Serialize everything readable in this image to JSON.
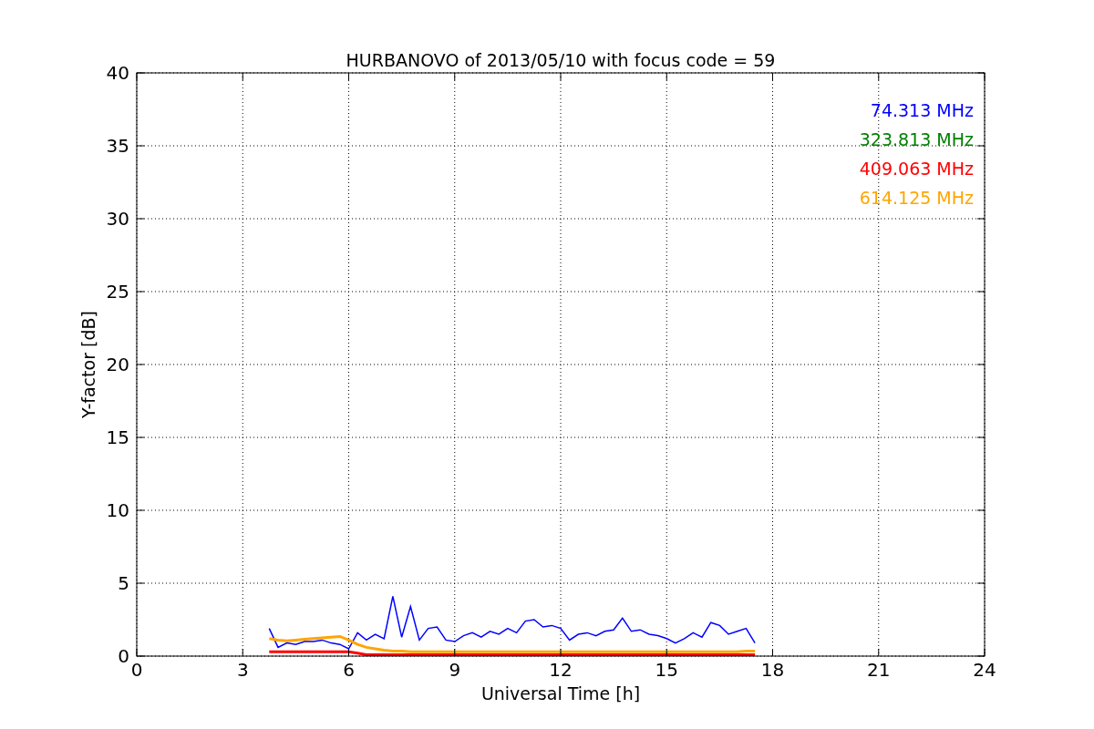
{
  "chart_data": {
    "type": "line",
    "title": "HURBANOVO of 2013/05/10 with focus code = 59",
    "xlabel": "Universal Time [h]",
    "ylabel": "Y-factor [dB]",
    "grid": true,
    "xlim": [
      0,
      24
    ],
    "ylim": [
      0,
      40
    ],
    "xticks": [
      0,
      3,
      6,
      9,
      12,
      15,
      18,
      21,
      24
    ],
    "yticks": [
      0,
      5,
      10,
      15,
      20,
      25,
      30,
      35,
      40
    ],
    "x": [
      3.75,
      4,
      4.25,
      4.5,
      4.75,
      5,
      5.25,
      5.5,
      5.75,
      6,
      6.25,
      6.5,
      6.75,
      7,
      7.25,
      7.5,
      7.75,
      8,
      8.25,
      8.5,
      8.75,
      9,
      9.25,
      9.5,
      9.75,
      10,
      10.25,
      10.5,
      10.75,
      11,
      11.25,
      11.5,
      11.75,
      12,
      12.25,
      12.5,
      12.75,
      13,
      13.25,
      13.5,
      13.75,
      14,
      14.25,
      14.5,
      14.75,
      15,
      15.25,
      15.5,
      15.75,
      16,
      16.25,
      16.5,
      16.75,
      17,
      17.25,
      17.5
    ],
    "series": [
      {
        "name": "74.313 MHz",
        "color": "#0000ff",
        "values": [
          1.9,
          0.6,
          0.9,
          0.8,
          1.0,
          1.0,
          1.1,
          0.9,
          0.8,
          0.5,
          1.6,
          1.1,
          1.5,
          1.2,
          4.1,
          1.3,
          3.4,
          1.1,
          1.9,
          2.0,
          1.1,
          1.0,
          1.4,
          1.6,
          1.3,
          1.7,
          1.5,
          1.9,
          1.6,
          2.4,
          2.5,
          2.0,
          2.1,
          1.9,
          1.1,
          1.5,
          1.6,
          1.4,
          1.7,
          1.8,
          2.6,
          1.7,
          1.8,
          1.5,
          1.4,
          1.2,
          0.9,
          1.2,
          1.6,
          1.3,
          2.3,
          2.1,
          1.5,
          1.7,
          1.9,
          0.9
        ]
      },
      {
        "name": "323.813 MHz",
        "color": "#008000",
        "values": [
          null,
          null,
          null,
          null,
          null,
          null,
          null,
          null,
          null,
          null,
          null,
          null,
          null,
          null,
          null,
          null,
          null,
          null,
          null,
          null,
          null,
          null,
          null,
          null,
          null,
          null,
          null,
          null,
          null,
          null,
          null,
          null,
          null,
          null,
          null,
          null,
          null,
          null,
          null,
          null,
          null,
          null,
          null,
          null,
          null,
          null,
          null,
          null,
          null,
          null,
          null,
          null,
          null,
          null,
          null,
          null
        ]
      },
      {
        "name": "409.063 MHz",
        "color": "#ff0000",
        "values": [
          0.3,
          0.3,
          0.3,
          0.3,
          0.3,
          0.3,
          0.3,
          0.3,
          0.3,
          0.3,
          0.2,
          0.1,
          0.1,
          0.1,
          0.1,
          0.1,
          0.1,
          0.1,
          0.1,
          0.1,
          0.1,
          0.1,
          0.1,
          0.1,
          0.1,
          0.1,
          0.1,
          0.1,
          0.1,
          0.1,
          0.1,
          0.1,
          0.1,
          0.1,
          0.1,
          0.1,
          0.1,
          0.1,
          0.1,
          0.1,
          0.1,
          0.1,
          0.1,
          0.1,
          0.1,
          0.1,
          0.1,
          0.1,
          0.1,
          0.1,
          0.1,
          0.1,
          0.1,
          0.1,
          0.1,
          0.1
        ]
      },
      {
        "name": "614.125 MHz",
        "color": "#ffa500",
        "values": [
          1.2,
          1.1,
          1.05,
          1.1,
          1.15,
          1.2,
          1.25,
          1.3,
          1.35,
          1.1,
          0.8,
          0.6,
          0.5,
          0.4,
          0.35,
          0.35,
          0.3,
          0.3,
          0.3,
          0.3,
          0.3,
          0.3,
          0.3,
          0.3,
          0.3,
          0.3,
          0.3,
          0.3,
          0.3,
          0.3,
          0.3,
          0.3,
          0.3,
          0.3,
          0.3,
          0.3,
          0.3,
          0.3,
          0.3,
          0.3,
          0.3,
          0.3,
          0.3,
          0.3,
          0.3,
          0.3,
          0.3,
          0.3,
          0.3,
          0.3,
          0.3,
          0.3,
          0.3,
          0.3,
          0.35,
          0.35
        ]
      }
    ]
  }
}
